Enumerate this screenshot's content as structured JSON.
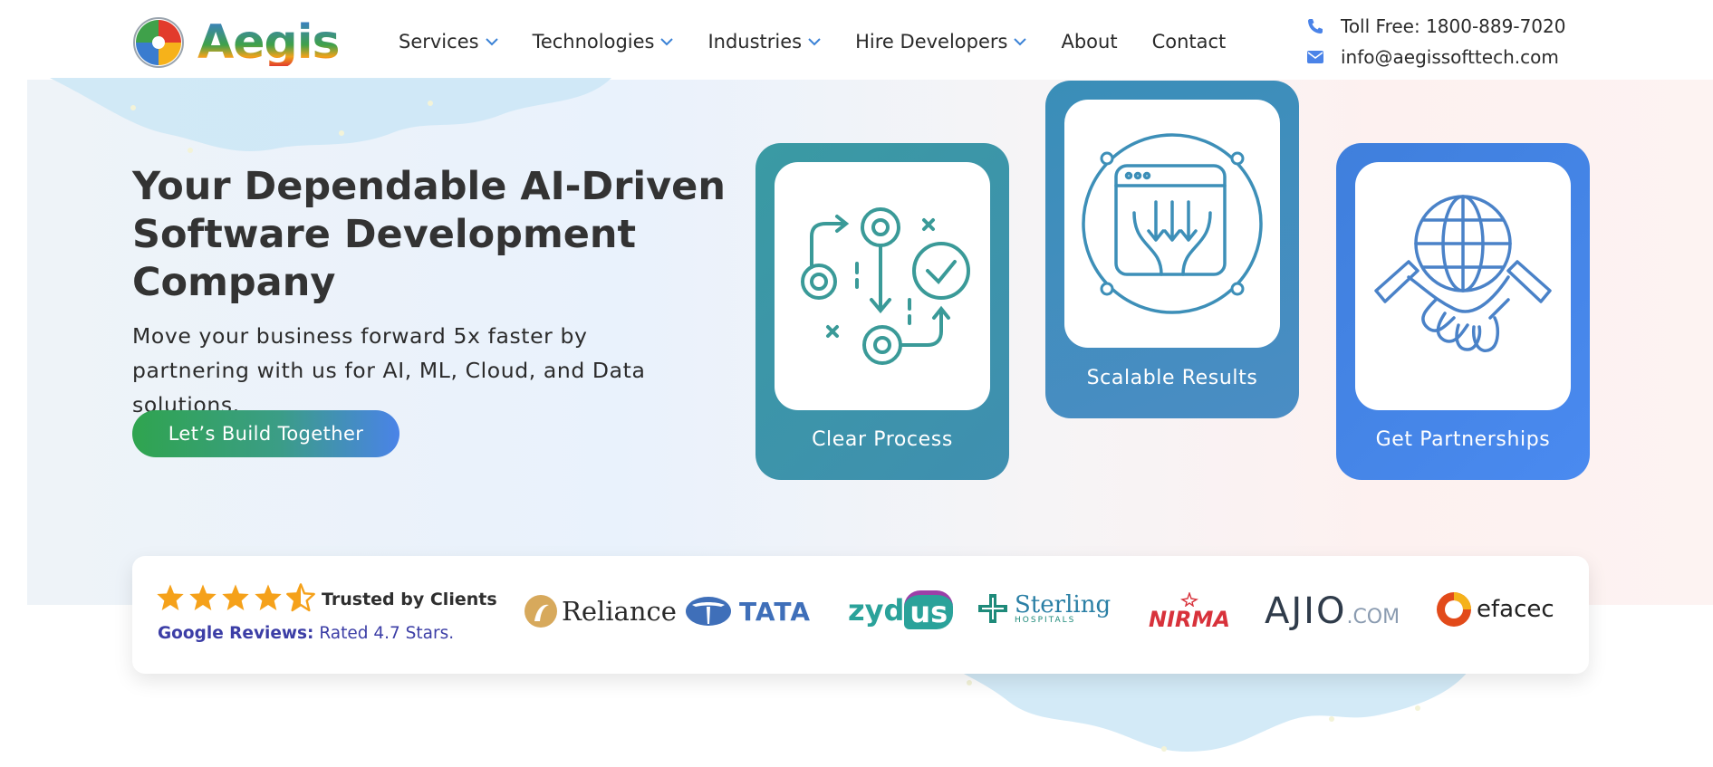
{
  "brand": {
    "name": "Aegis"
  },
  "nav": {
    "items": [
      {
        "label": "Services",
        "has_dropdown": true
      },
      {
        "label": "Technologies",
        "has_dropdown": true
      },
      {
        "label": "Industries",
        "has_dropdown": true
      },
      {
        "label": "Hire Developers",
        "has_dropdown": true
      },
      {
        "label": "About",
        "has_dropdown": false
      },
      {
        "label": "Contact",
        "has_dropdown": false
      }
    ]
  },
  "contact": {
    "phone": "Toll Free: 1800-889-7020",
    "email": "info@aegissofttech.com"
  },
  "hero": {
    "title": "Your Dependable AI-Driven Software Development Company",
    "subtitle": "Move your business forward 5x faster by partnering with us for AI, ML, Cloud, and Data solutions.",
    "cta_label": "Let’s Build Together"
  },
  "features": [
    {
      "label": "Clear Process",
      "icon": "process-flow-icon"
    },
    {
      "label": "Scalable Results",
      "icon": "scalable-results-icon"
    },
    {
      "label": "Get Partnerships",
      "icon": "partnership-handshake-icon"
    }
  ],
  "trust": {
    "stars": 4.5,
    "trusted_label": "Trusted by Clients",
    "reviews_source": "Google Reviews:",
    "reviews_text": "Rated 4.7 Stars.",
    "clients": [
      {
        "name": "Reliance",
        "display": "Reliance"
      },
      {
        "name": "TATA",
        "display": "TATA"
      },
      {
        "name": "zydus",
        "display_a": "zyd",
        "display_b": "us"
      },
      {
        "name": "Sterling Hospitals",
        "display": "Sterling",
        "sub": "HOSPITALS"
      },
      {
        "name": "NIRMA",
        "display": "NIRMA"
      },
      {
        "name": "AJIO.com",
        "display_a": "AJIO",
        "display_b": ".COM"
      },
      {
        "name": "efacec",
        "display": "efacec"
      }
    ]
  },
  "colors": {
    "accent_blue": "#4a83e8",
    "accent_green": "#2fa44f",
    "teal_card": "#3a9aa3",
    "steel_card": "#3f8fc0",
    "blue_card": "#4587e6",
    "star_orange": "#f5a11a",
    "reviews_purple": "#3c3ea6"
  }
}
